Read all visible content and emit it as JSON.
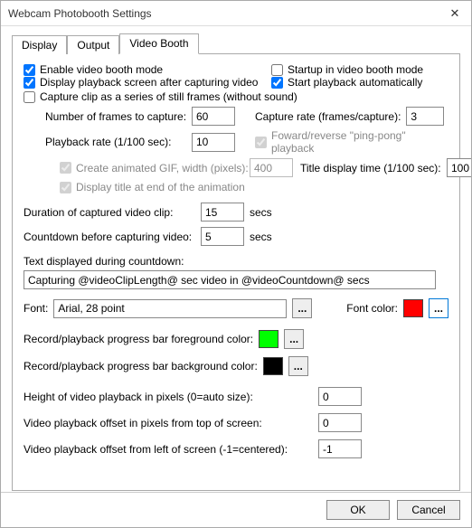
{
  "title": "Webcam Photobooth Settings",
  "tabs": {
    "display": "Display",
    "output": "Output",
    "videoBooth": "Video Booth"
  },
  "checkboxes": {
    "enable": "Enable video booth mode",
    "startup": "Startup in video booth mode",
    "displayPlayback": "Display playback screen after capturing video",
    "startAuto": "Start playback automatically",
    "captureSeries": "Capture clip as a series of still frames (without sound)",
    "pingpong": "Foward/reverse \"ping-pong\" playback",
    "animGif": "Create animated GIF, width (pixels):",
    "displayTitle": "Display title at end of the animation"
  },
  "labels": {
    "numFrames": "Number of frames to capture:",
    "captureRate": "Capture rate (frames/capture):",
    "playbackRate": "Playback rate (1/100 sec):",
    "titleDisplayTime": "Title display time (1/100 sec):",
    "duration": "Duration of captured video clip:",
    "countdown": "Countdown before capturing video:",
    "secs": "secs",
    "countdownText": "Text displayed during countdown:",
    "font": "Font:",
    "fontColor": "Font color:",
    "progressFg": "Record/playback progress bar foreground color:",
    "progressBg": "Record/playback progress bar background color:",
    "heightPlayback": "Height of video playback in pixels (0=auto size):",
    "offsetTop": "Video playback offset in pixels from top of screen:",
    "offsetLeft": "Video playback offset from left of screen (-1=centered):",
    "ok": "OK",
    "cancel": "Cancel",
    "dots": "..."
  },
  "values": {
    "numFrames": "60",
    "captureRate": "3",
    "playbackRate": "10",
    "gifWidth": "400",
    "titleDisplayTime": "100",
    "duration": "15",
    "countdown": "5",
    "countdownText": "Capturing @videoClipLength@ sec video in @videoCountdown@ secs",
    "font": "Arial, 28 point",
    "heightPlayback": "0",
    "offsetTop": "0",
    "offsetLeft": "-1"
  },
  "colors": {
    "fontColor": "#ff0000",
    "progressFg": "#00ff00",
    "progressBg": "#000000"
  }
}
